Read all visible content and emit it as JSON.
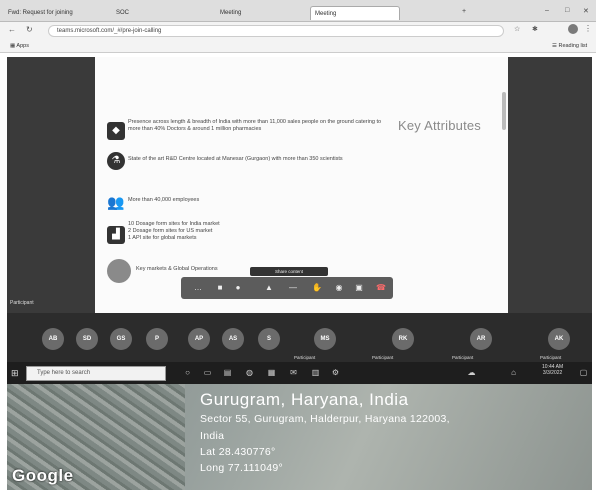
{
  "browser": {
    "tabs": [
      {
        "label": "Fwd: Request for joining",
        "active": false
      },
      {
        "label": "SOC",
        "active": false
      },
      {
        "label": "Meeting",
        "active": false
      },
      {
        "label": "Meeting",
        "active": true
      },
      {
        "label": "",
        "active": false
      }
    ],
    "url": "teams.microsoft.com/_#/pre-join-calling",
    "bookmarks": {
      "apps": "Apps",
      "reading_list": "Reading list"
    }
  },
  "slide": {
    "title": "Key Attributes",
    "attributes": [
      {
        "icon": "india-map-icon",
        "text": "Presence across length & breadth of India with more than 11,000 sales people on the ground catering to more than 40% Doctors & around 1 million pharmacies"
      },
      {
        "icon": "microscope-icon",
        "text": "State of the art R&D Centre located at Manesar (Gurgaon) with more than 350 scientists"
      },
      {
        "icon": "people-icon",
        "text": "More than 40,000 employees"
      },
      {
        "icon": "factory-icon",
        "text": "10 Dosage form sites for India market\n2 Dosage form sites for US market\n1 API site for global markets"
      },
      {
        "icon": "avatar-icon",
        "text": "Key markets & Global Operations"
      }
    ]
  },
  "meeting": {
    "left_tile_name": "Participant",
    "control_tooltip": "Share content",
    "participants": [
      {
        "initials": "AB",
        "name": ""
      },
      {
        "initials": "SD",
        "name": ""
      },
      {
        "initials": "GS",
        "name": ""
      },
      {
        "initials": "P",
        "name": ""
      },
      {
        "initials": "AP",
        "name": ""
      },
      {
        "initials": "AS",
        "name": ""
      },
      {
        "initials": "S",
        "name": ""
      },
      {
        "initials": "MS",
        "name": "Participant"
      },
      {
        "initials": "RK",
        "name": "Participant"
      },
      {
        "initials": "AR",
        "name": "Participant"
      },
      {
        "initials": "AK",
        "name": "Participant"
      }
    ]
  },
  "taskbar": {
    "search_placeholder": "Type here to search",
    "time": "10:44 AM",
    "date": "3/3/2022"
  },
  "location": {
    "title": "Gurugram, Haryana, India",
    "address_line1": "Sector 55, Gurugram, Halderpur, Haryana 122003,",
    "address_line2": "India",
    "lat": "Lat 28.430776°",
    "long": "Long 77.111049°",
    "map_logo": "Google"
  }
}
